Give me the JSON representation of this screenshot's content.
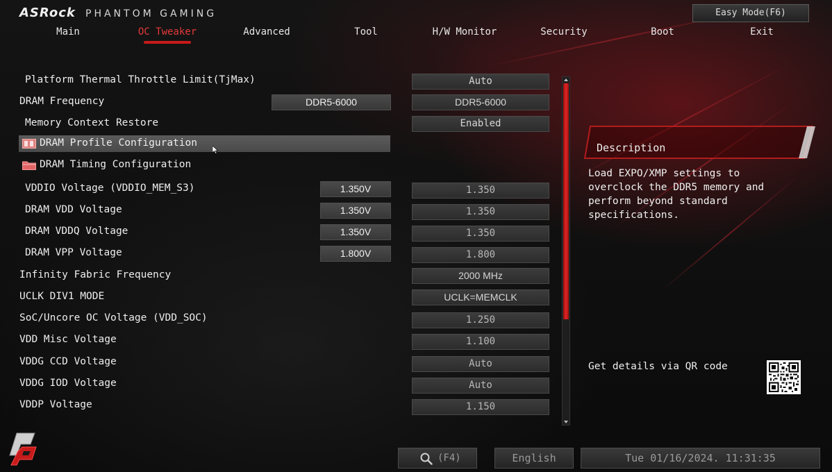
{
  "header": {
    "brand": "ASRock",
    "brand_sub": "PHANTOM GAMING",
    "easy_mode": "Easy Mode(F6)"
  },
  "tabs": [
    {
      "label": "Main"
    },
    {
      "label": "OC Tweaker"
    },
    {
      "label": "Advanced"
    },
    {
      "label": "Tool"
    },
    {
      "label": "H/W Monitor"
    },
    {
      "label": "Security"
    },
    {
      "label": "Boot"
    },
    {
      "label": "Exit"
    }
  ],
  "active_tab": "OC Tweaker",
  "settings": [
    {
      "label": "Platform Thermal Throttle Limit(TjMax)",
      "value": "Auto"
    },
    {
      "label": "DRAM Frequency",
      "current": "DDR5-6000",
      "value": "DDR5-6000"
    },
    {
      "label": "Memory Context Restore",
      "value": "Enabled"
    },
    {
      "label": "DRAM Profile Configuration"
    },
    {
      "label": "DRAM Timing Configuration"
    },
    {
      "label": "VDDIO Voltage (VDDIO_MEM_S3)",
      "current": "1.350V",
      "value": "1.350"
    },
    {
      "label": "DRAM VDD Voltage",
      "current": "1.350V",
      "value": "1.350"
    },
    {
      "label": "DRAM VDDQ Voltage",
      "current": "1.350V",
      "value": "1.350"
    },
    {
      "label": "DRAM VPP Voltage",
      "current": "1.800V",
      "value": "1.800"
    },
    {
      "label": "Infinity Fabric Frequency",
      "value": "2000 MHz"
    },
    {
      "label": "UCLK DIV1 MODE",
      "value": "UCLK=MEMCLK"
    },
    {
      "label": "SoC/Uncore OC Voltage (VDD_SOC)",
      "value": "1.250"
    },
    {
      "label": "VDD Misc Voltage",
      "value": "1.100"
    },
    {
      "label": "VDDG CCD Voltage",
      "value": "Auto"
    },
    {
      "label": "VDDG IOD Voltage",
      "value": "Auto"
    },
    {
      "label": "VDDP Voltage",
      "value": "1.150"
    }
  ],
  "selected_setting": "DRAM Profile Configuration",
  "scroll_position": 0.0,
  "description": {
    "title": "Description",
    "text": "Load EXPO/XMP settings to overclock the DDR5 memory and perform beyond standard specifications.",
    "qr_label": "Get details via QR code"
  },
  "footer": {
    "search_key": "(F4)",
    "language": "English",
    "datetime": "Tue 01/16/2024. 11:31:35"
  },
  "colors": {
    "accent_red": "#e43a3a",
    "scrollbar_red": "#e02424"
  },
  "icons": [
    "folder-icon",
    "search-icon",
    "scroll-up-icon",
    "scroll-down-icon",
    "qr-code-icon",
    "pg-logo-icon"
  ]
}
